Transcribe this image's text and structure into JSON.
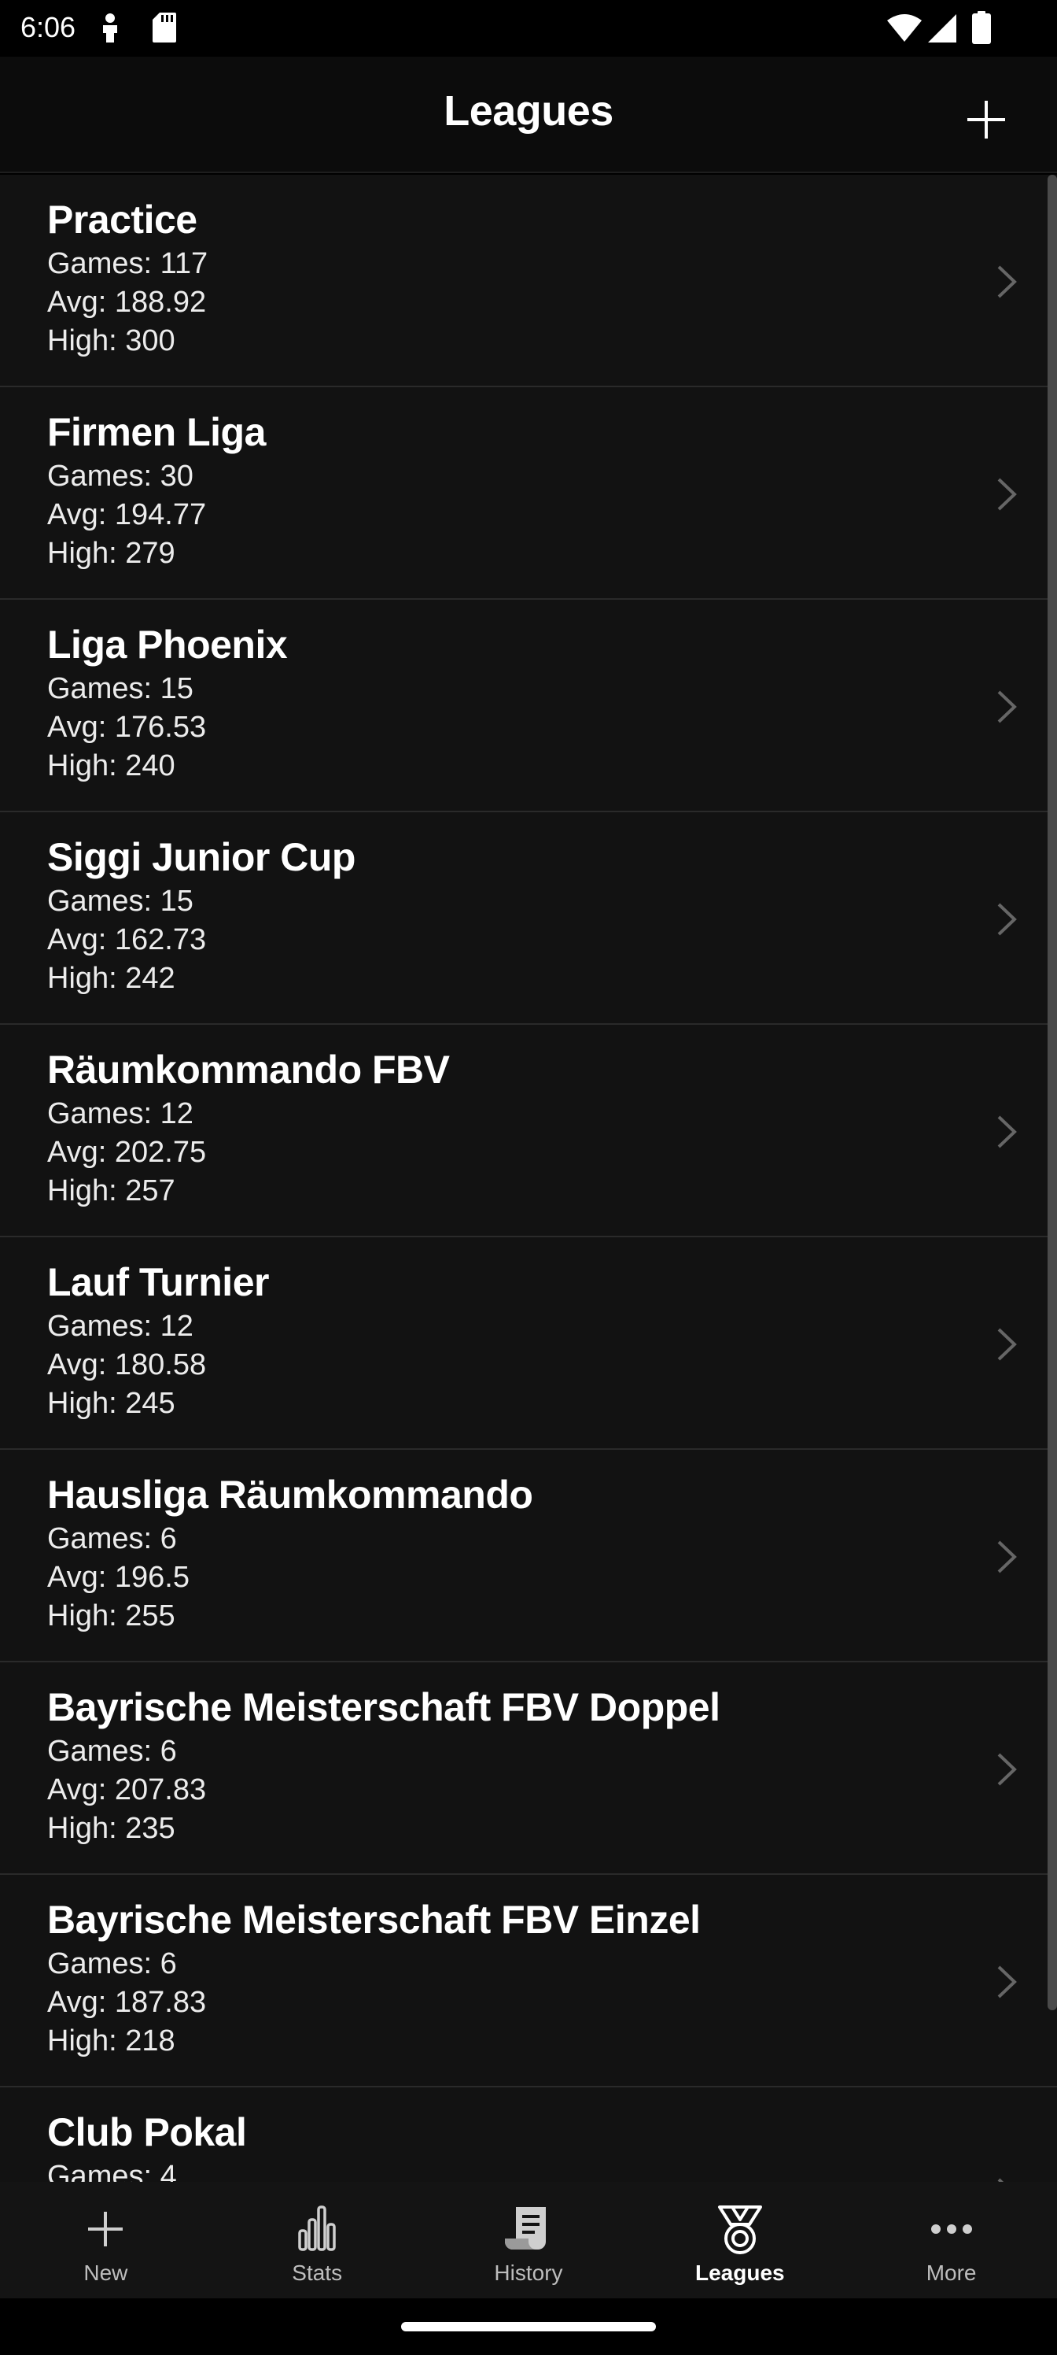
{
  "status_bar": {
    "time": "6:06",
    "left_icons": [
      "person-notification-icon",
      "sd-card-icon"
    ],
    "right_icons": [
      "wifi-icon",
      "cell-signal-icon",
      "battery-icon"
    ]
  },
  "header": {
    "title": "Leagues",
    "add_icon": "plus-icon"
  },
  "leagues": [
    {
      "name": "Practice",
      "games": "Games: 117",
      "avg": "Avg: 188.92",
      "high": "High: 300"
    },
    {
      "name": "Firmen Liga",
      "games": "Games: 30",
      "avg": "Avg: 194.77",
      "high": "High: 279"
    },
    {
      "name": "Liga Phoenix",
      "games": "Games: 15",
      "avg": "Avg: 176.53",
      "high": "High: 240"
    },
    {
      "name": "Siggi Junior Cup",
      "games": "Games: 15",
      "avg": "Avg: 162.73",
      "high": "High: 242"
    },
    {
      "name": "Räumkommando FBV",
      "games": "Games: 12",
      "avg": "Avg: 202.75",
      "high": "High: 257"
    },
    {
      "name": "Lauf Turnier",
      "games": "Games: 12",
      "avg": "Avg: 180.58",
      "high": "High: 245"
    },
    {
      "name": "Hausliga Räumkommando",
      "games": "Games: 6",
      "avg": "Avg: 196.5",
      "high": "High: 255"
    },
    {
      "name": "Bayrische Meisterschaft FBV Doppel",
      "games": "Games: 6",
      "avg": "Avg: 207.83",
      "high": "High: 235"
    },
    {
      "name": "Bayrische Meisterschaft FBV Einzel",
      "games": "Games: 6",
      "avg": "Avg: 187.83",
      "high": "High: 218"
    },
    {
      "name": "Club Pokal",
      "games": "Games: 4",
      "avg": "",
      "high": ""
    }
  ],
  "bottom_nav": {
    "active": "Leagues",
    "items": [
      {
        "label": "New",
        "icon": "plus-icon"
      },
      {
        "label": "Stats",
        "icon": "bar-chart-icon"
      },
      {
        "label": "History",
        "icon": "scroll-icon"
      },
      {
        "label": "Leagues",
        "icon": "medal-icon"
      },
      {
        "label": "More",
        "icon": "more-dots-icon"
      }
    ]
  },
  "colors": {
    "background": "#000000",
    "list_background": "#121212",
    "divider": "#2a2a2a",
    "text": "#ffffff",
    "inactive_nav": "#bdbdbd"
  }
}
